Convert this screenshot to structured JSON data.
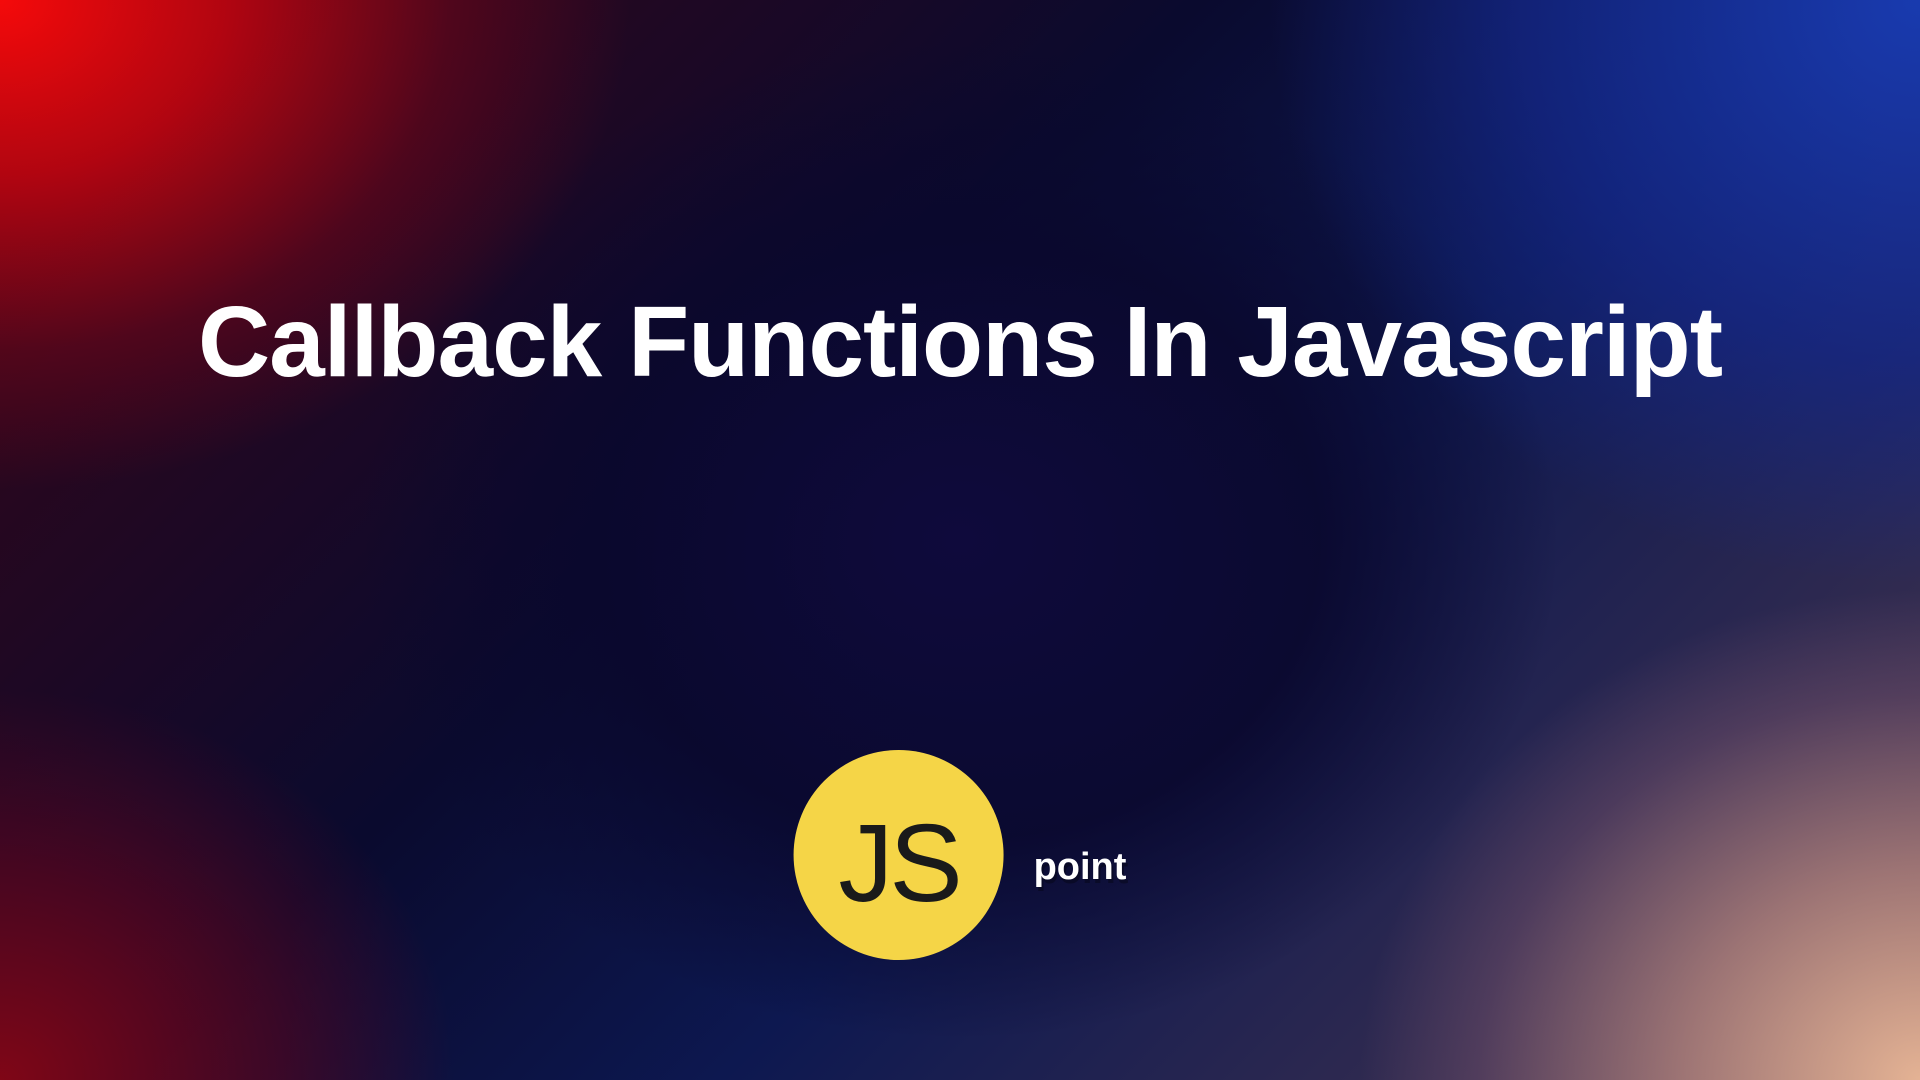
{
  "title": "Callback Functions In Javascript",
  "logo": {
    "badge_text": "JS",
    "suffix": "point",
    "circle_color": "#f5d547",
    "text_color": "#1a1a1a"
  }
}
